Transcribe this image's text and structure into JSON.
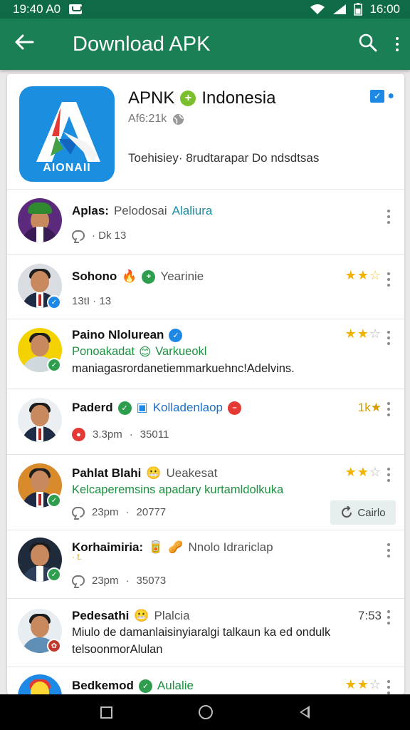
{
  "status_bar": {
    "time_left": "19:40 A0",
    "time_right": "16:00"
  },
  "app_bar": {
    "title": "Download APK"
  },
  "app_info": {
    "icon_label": "AIONAII",
    "name": "APNK",
    "region": "Indonesia",
    "meta": "Af6:21k",
    "description": "Toehisiey· 8rudtarapar  Do ndsdtsas"
  },
  "rows": [
    {
      "name": "Aplas:",
      "tag": "Pelodosai",
      "tag2": "Alaliura",
      "meta": "· Dk  13",
      "stars": 0
    },
    {
      "name": "Sohono",
      "tag": "Yearinie",
      "meta": "13tI  ·  13",
      "stars": 2.5
    },
    {
      "name": "Paino Nlolurean",
      "text1": "Ponoakadat",
      "text1b": "Varkueokl",
      "text2": "maniagasrordanetiemmarkuehnc!Adelvins.",
      "stars": 2
    },
    {
      "name": "Paderd",
      "tag": "Kolladenlaop",
      "meta_time": "3.3pm",
      "meta_num": "35011",
      "right_text": "1k★"
    },
    {
      "name": "Pahlat Blahi",
      "tag": "Ueakesat",
      "text1": "Kelcaperemsins apadary kurtamldolkuka",
      "meta_time": "23pm",
      "meta_num": "20777",
      "stars": 2,
      "button": "Cairlo"
    },
    {
      "name": "Korhaimiria:",
      "tag": "Nnolo Idrariclap",
      "sub": "·  t.",
      "meta_time": "23pm",
      "meta_num": "35073"
    },
    {
      "name": "Pedesathi",
      "tag": "Plalcia",
      "text1": "Miulo de damanlaisinyiaralgi talkaun ka ed ondulk",
      "text2": "telsoonmorAlulan",
      "time": "7:53"
    },
    {
      "name": "Bedkemod",
      "tag": "Aulalie",
      "stars": 2
    }
  ],
  "colors": {
    "status_bar": "#0f6b46",
    "app_bar": "#1b7f55",
    "star": "#f2b200",
    "accent_teal": "#1a8aa0"
  },
  "icons": [
    "back-arrow-icon",
    "search-icon",
    "more-vert-icon",
    "verified-icon",
    "globe-icon",
    "comment-icon",
    "share-icon"
  ]
}
